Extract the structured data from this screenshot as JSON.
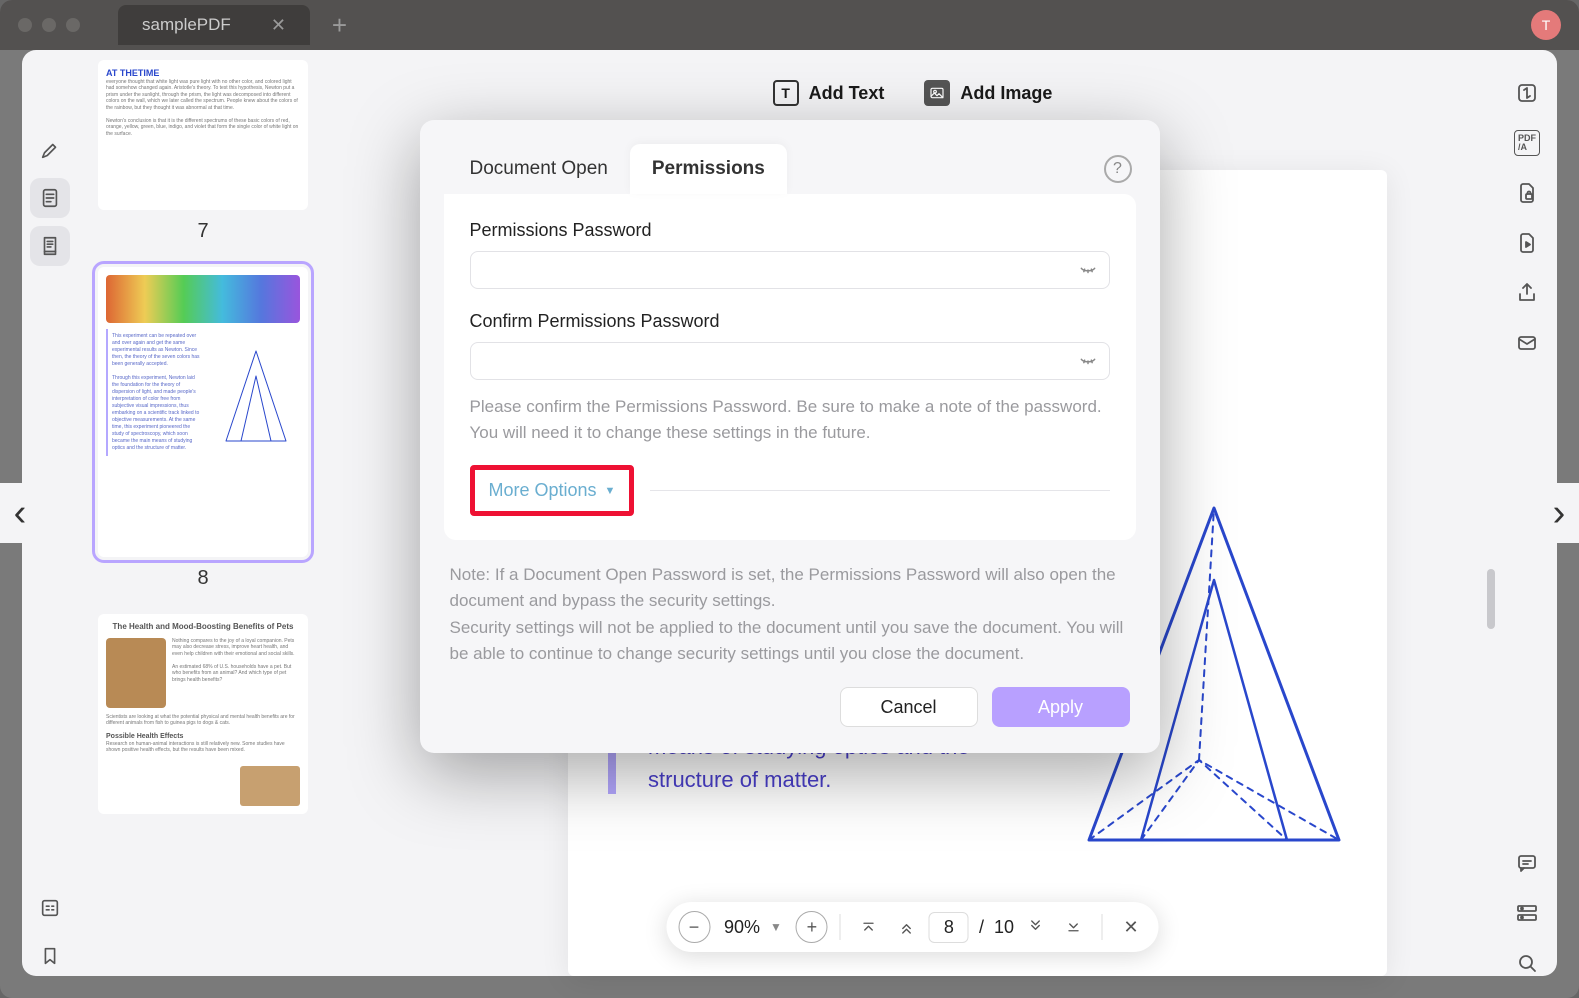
{
  "titlebar": {
    "tab_name": "samplePDF",
    "avatar_letter": "T"
  },
  "toolbar": {
    "add_text": "Add Text",
    "add_image": "Add Image"
  },
  "thumbnails": {
    "p7": {
      "num": "7",
      "title": "AT THETIME"
    },
    "p8": {
      "num": "8"
    },
    "p9_title": "The Health and Mood-Boosting Benefits of Pets",
    "p9_h2": "Possible Health Effects"
  },
  "page_text": {
    "line1": "means of studying optics and the",
    "line2": "structure of matter."
  },
  "bottombar": {
    "zoom": "90%",
    "page_current": "8",
    "page_total": "10",
    "page_sep": "/"
  },
  "modal": {
    "tab_doc_open": "Document Open",
    "tab_permissions": "Permissions",
    "label_pw": "Permissions Password",
    "label_confirm": "Confirm Permissions Password",
    "hint": "Please confirm the Permissions Password. Be sure to make a note of the password. You will need it to change these settings in the future.",
    "more_options": "More Options",
    "note1": "Note: If a Document Open Password is set, the Permissions Password will also open the document and bypass the security settings.",
    "note2": "Security settings will not be applied to the document until you save the document. You will be able to continue to change security settings until you close the document.",
    "cancel": "Cancel",
    "apply": "Apply"
  }
}
